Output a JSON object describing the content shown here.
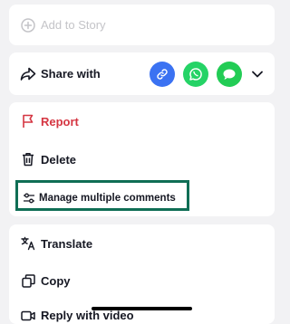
{
  "sheet": {
    "add_to_story": {
      "label": "Add to Story",
      "icon": "add-circle-icon"
    },
    "share": {
      "label": "Share with",
      "icon": "share-arrow-icon",
      "apps": [
        {
          "name": "link-icon",
          "color": "#3b72f2"
        },
        {
          "name": "whatsapp-icon",
          "color": "#25d366"
        },
        {
          "name": "message-icon",
          "color": "#22cc55"
        }
      ],
      "expand_icon": "chevron-down-icon"
    },
    "actions": [
      {
        "label": "Report",
        "icon": "flag-icon",
        "color": "#d53642"
      },
      {
        "label": "Delete",
        "icon": "trash-icon"
      },
      {
        "label": "Manage multiple comments",
        "icon": "sliders-icon"
      }
    ],
    "more": [
      {
        "label": "Translate",
        "icon": "translate-icon"
      },
      {
        "label": "Copy",
        "icon": "copy-icon"
      },
      {
        "label": "Reply with video",
        "icon": "video-icon"
      }
    ]
  },
  "colors": {
    "background": "#f2f2f4",
    "card": "#ffffff",
    "danger": "#d53642",
    "highlight_border": "#0f6e55"
  }
}
